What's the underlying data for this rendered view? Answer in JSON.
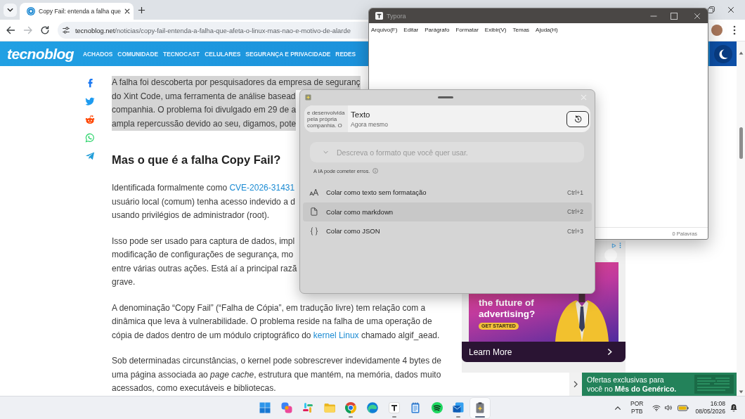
{
  "browser": {
    "tabs": [
      {
        "title": "Copy Fail: entenda a falha que",
        "selected": true
      }
    ],
    "nav_buttons": [
      {
        "kind": "back",
        "disabled": false
      },
      {
        "kind": "forward",
        "disabled": true
      },
      {
        "kind": "reload",
        "disabled": false
      }
    ],
    "address": {
      "host": "tecnoblog.net",
      "path": "/noticias/copy-fail-entenda-a-falha-que-afeta-o-linux-mas-nao-e-motivo-de-alarde"
    }
  },
  "site": {
    "logo": "tecnoblog",
    "menu": [
      "ACHADOS",
      "COMUNIDADE",
      "TECNOCAST",
      "CELULARES",
      "SEGURANÇA E PRIVACIDADE",
      "REDES"
    ]
  },
  "share_buttons": [
    {
      "kind": "f"
    },
    {
      "kind": "bird"
    },
    {
      "kind": "alien"
    },
    {
      "kind": "chat"
    },
    {
      "kind": "plane"
    }
  ],
  "article": {
    "blocks": [
      {
        "kind": "lines",
        "highlighted": true,
        "lines": [
          [
            {
              "kind": "plain",
              "text": "A falha foi descoberta por pesquisadores da empresa de seguranç"
            }
          ],
          [
            {
              "kind": "plain",
              "text": "do Xint Code, uma ferramenta de análise basead"
            }
          ],
          [
            {
              "kind": "plain",
              "text": "companhia. O problema foi divulgado em 29 de a"
            }
          ],
          [
            {
              "kind": "plain",
              "text": "ampla repercussão devido ao seu, digamos, pote"
            }
          ]
        ]
      },
      {
        "kind": "heading",
        "highlighted": false,
        "text": "Mas o que é a falha Copy Fail?"
      },
      {
        "kind": "paragraph",
        "highlighted": false,
        "lines": [
          [
            {
              "kind": "plain",
              "text": "Identificada formalmente como "
            },
            {
              "kind": "link",
              "text": "CVE-2026-31431"
            }
          ],
          [
            {
              "kind": "plain",
              "text": "usuário local (comum) tenha acesso indevido a d"
            }
          ],
          [
            {
              "kind": "plain",
              "text": "usando privilégios de administrador (root)."
            }
          ]
        ]
      },
      {
        "kind": "paragraph",
        "highlighted": false,
        "lines": [
          [
            {
              "kind": "plain",
              "text": "Isso pode ser usado para captura de dados, impl"
            }
          ],
          [
            {
              "kind": "plain",
              "text": "modificação de configurações de segurança, mo"
            }
          ],
          [
            {
              "kind": "plain",
              "text": "entre várias outras ações. Está aí a principal razã"
            }
          ],
          [
            {
              "kind": "plain",
              "text": "grave."
            }
          ]
        ]
      },
      {
        "kind": "paragraph",
        "highlighted": false,
        "lines": [
          [
            {
              "kind": "plain",
              "text": "A denominação “Copy Fail” (“Falha de Cópia”, em tradução livre) tem relação com a"
            }
          ],
          [
            {
              "kind": "plain",
              "text": "dinâmica que leva à vulnerabilidade. O problema reside na falha de uma operação de"
            }
          ],
          [
            {
              "kind": "plain",
              "text": "cópia de dados dentro de um módulo criptográfico do "
            },
            {
              "kind": "link",
              "text": "kernel Linux"
            },
            {
              "kind": "plain",
              "text": " chamado algif_aead."
            }
          ]
        ]
      },
      {
        "kind": "paragraph",
        "highlighted": false,
        "lines": [
          [
            {
              "kind": "plain",
              "text": "Sob determinadas circunstâncias, o kernel pode sobrescrever indevidamente 4 bytes de"
            }
          ],
          [
            {
              "kind": "plain",
              "text": "uma página associada ao "
            },
            {
              "kind": "italic",
              "text": "page cache"
            },
            {
              "kind": "plain",
              "text": ", estrutura que mantém, na memória, dados muito"
            }
          ],
          [
            {
              "kind": "plain",
              "text": "acessados, como executáveis e bibliotecas."
            }
          ]
        ]
      }
    ]
  },
  "ad": {
    "headline": "the future of advertising?",
    "cta": "GET STARTED",
    "footer": "Learn More"
  },
  "promo": {
    "lines": [
      "Ofertas exclusivas para",
      "você no **Mês do Genérico.**"
    ]
  },
  "typora": {
    "title": "Typora",
    "menu": [
      "Arquivo(F)",
      "Editar",
      "Parágrafo",
      "Formatar",
      "Exibir(V)",
      "Temas",
      "Ajuda(H)"
    ],
    "status": "0 Palavras"
  },
  "paste_dialog": {
    "clip": {
      "preview": [
        "e desenvolvida",
        "pela própria",
        "companhia. O"
      ],
      "title": "Texto",
      "time": "Agora mesmo"
    },
    "prompt": {
      "placeholder": "Descreva o formato que você quer usar."
    },
    "disclaimer": "A IA pode cometer erros.",
    "options": [
      {
        "kind": "plain",
        "label": "Colar como texto sem formatação",
        "shortcut": "Ctrl+1",
        "selected": false
      },
      {
        "kind": "markdown",
        "label": "Colar como markdown",
        "shortcut": "Ctrl+2",
        "selected": true
      },
      {
        "kind": "json",
        "label": "Colar como JSON",
        "shortcut": "Ctrl+3",
        "selected": false
      }
    ]
  },
  "taskbar": {
    "apps": [
      {
        "kind": "start",
        "running": false,
        "selected": false
      },
      {
        "kind": "swirl",
        "running": false,
        "selected": false
      },
      {
        "kind": "pinwheel",
        "running": false,
        "selected": false
      },
      {
        "kind": "folder",
        "running": false,
        "selected": false
      },
      {
        "kind": "ring",
        "running": true,
        "selected": false
      },
      {
        "kind": "wave",
        "running": false,
        "selected": false
      },
      {
        "kind": "letter",
        "running": true,
        "selected": false
      },
      {
        "kind": "notepad",
        "running": false,
        "selected": false
      },
      {
        "kind": "arcs",
        "running": false,
        "selected": false
      },
      {
        "kind": "mail",
        "running": true,
        "selected": false
      },
      {
        "kind": "clipboard",
        "running": true,
        "selected": true
      }
    ],
    "tray": {
      "language": "POR",
      "layout": "PTB",
      "time": "16:08",
      "date": "08/05/2026"
    }
  }
}
